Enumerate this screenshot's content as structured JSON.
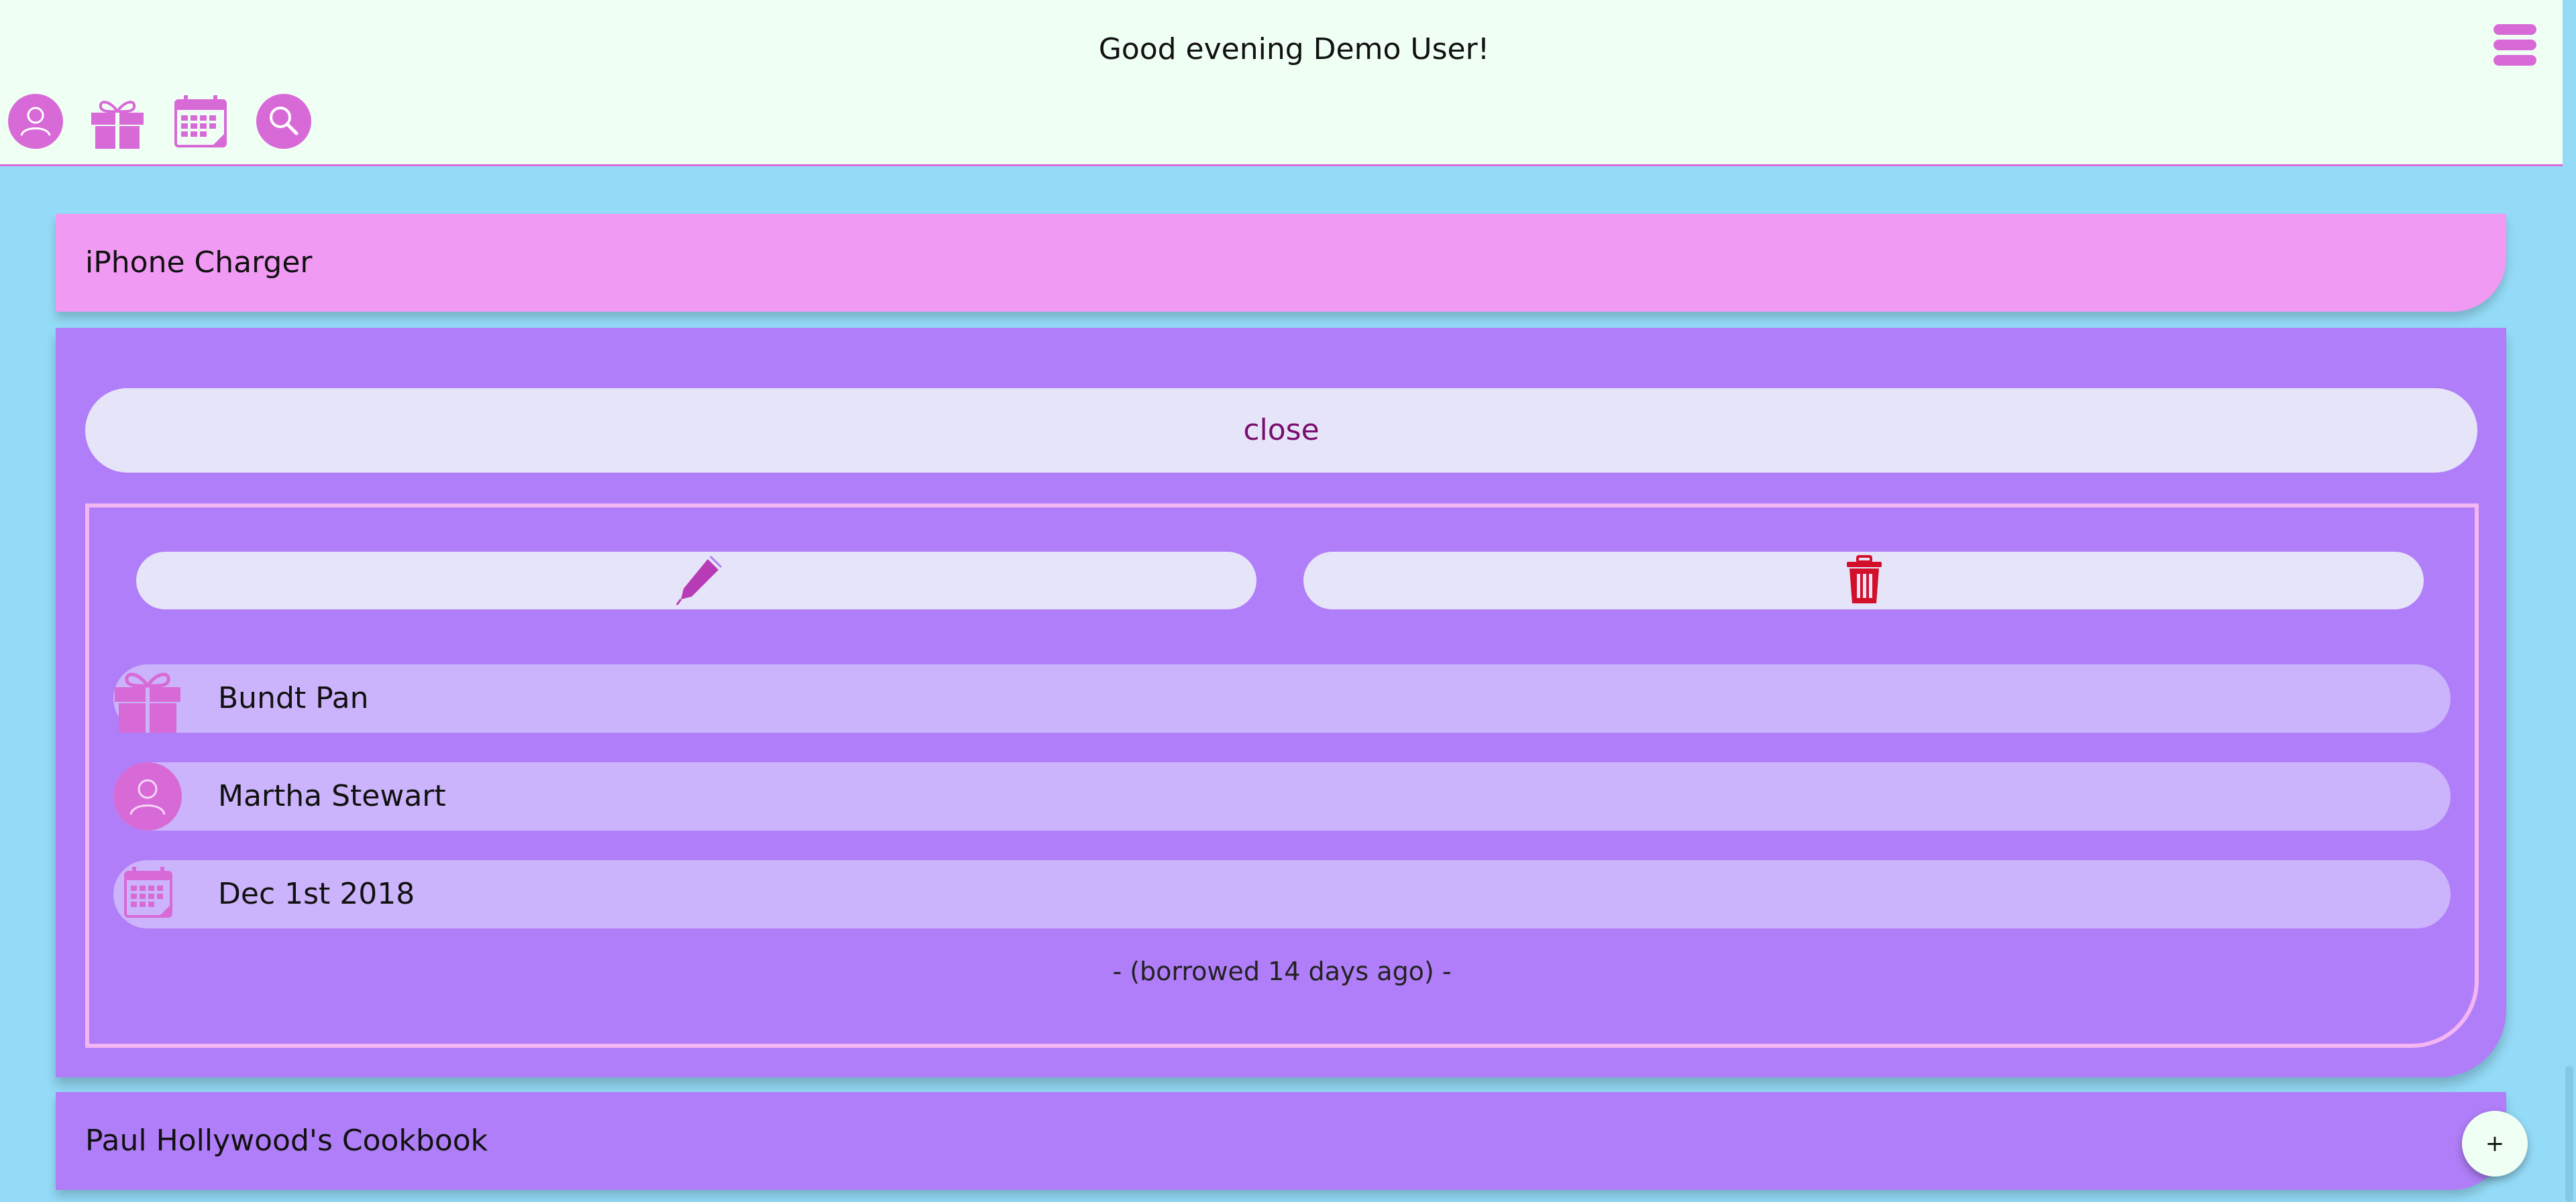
{
  "header": {
    "greeting": "Good evening Demo User!",
    "icons": [
      "user-icon",
      "gift-icon",
      "calendar-icon",
      "search-icon",
      "menu-icon"
    ]
  },
  "items": [
    {
      "title": "iPhone Charger",
      "expanded": true
    },
    {
      "title": "Paul Hollywood's Cookbook",
      "expanded": false
    }
  ],
  "detail": {
    "close_label": "close",
    "edit_icon": "pencil-icon",
    "delete_icon": "trash-icon",
    "item_name": "Bundt Pan",
    "person": "Martha Stewart",
    "date": "Dec 1st 2018",
    "borrowed_note": "- (borrowed 14 days ago) -"
  },
  "fab": {
    "label": "+"
  },
  "colors": {
    "header_bg": "#f0fff4",
    "page_bg": "#94dbf7",
    "accent_pink": "#d86ad8",
    "card_pink": "#f09af3",
    "card_purple": "#b07ef8",
    "row_lavender": "#cbb4fb",
    "button_bg": "#e6e4f9",
    "delete_red": "#d3102a"
  }
}
